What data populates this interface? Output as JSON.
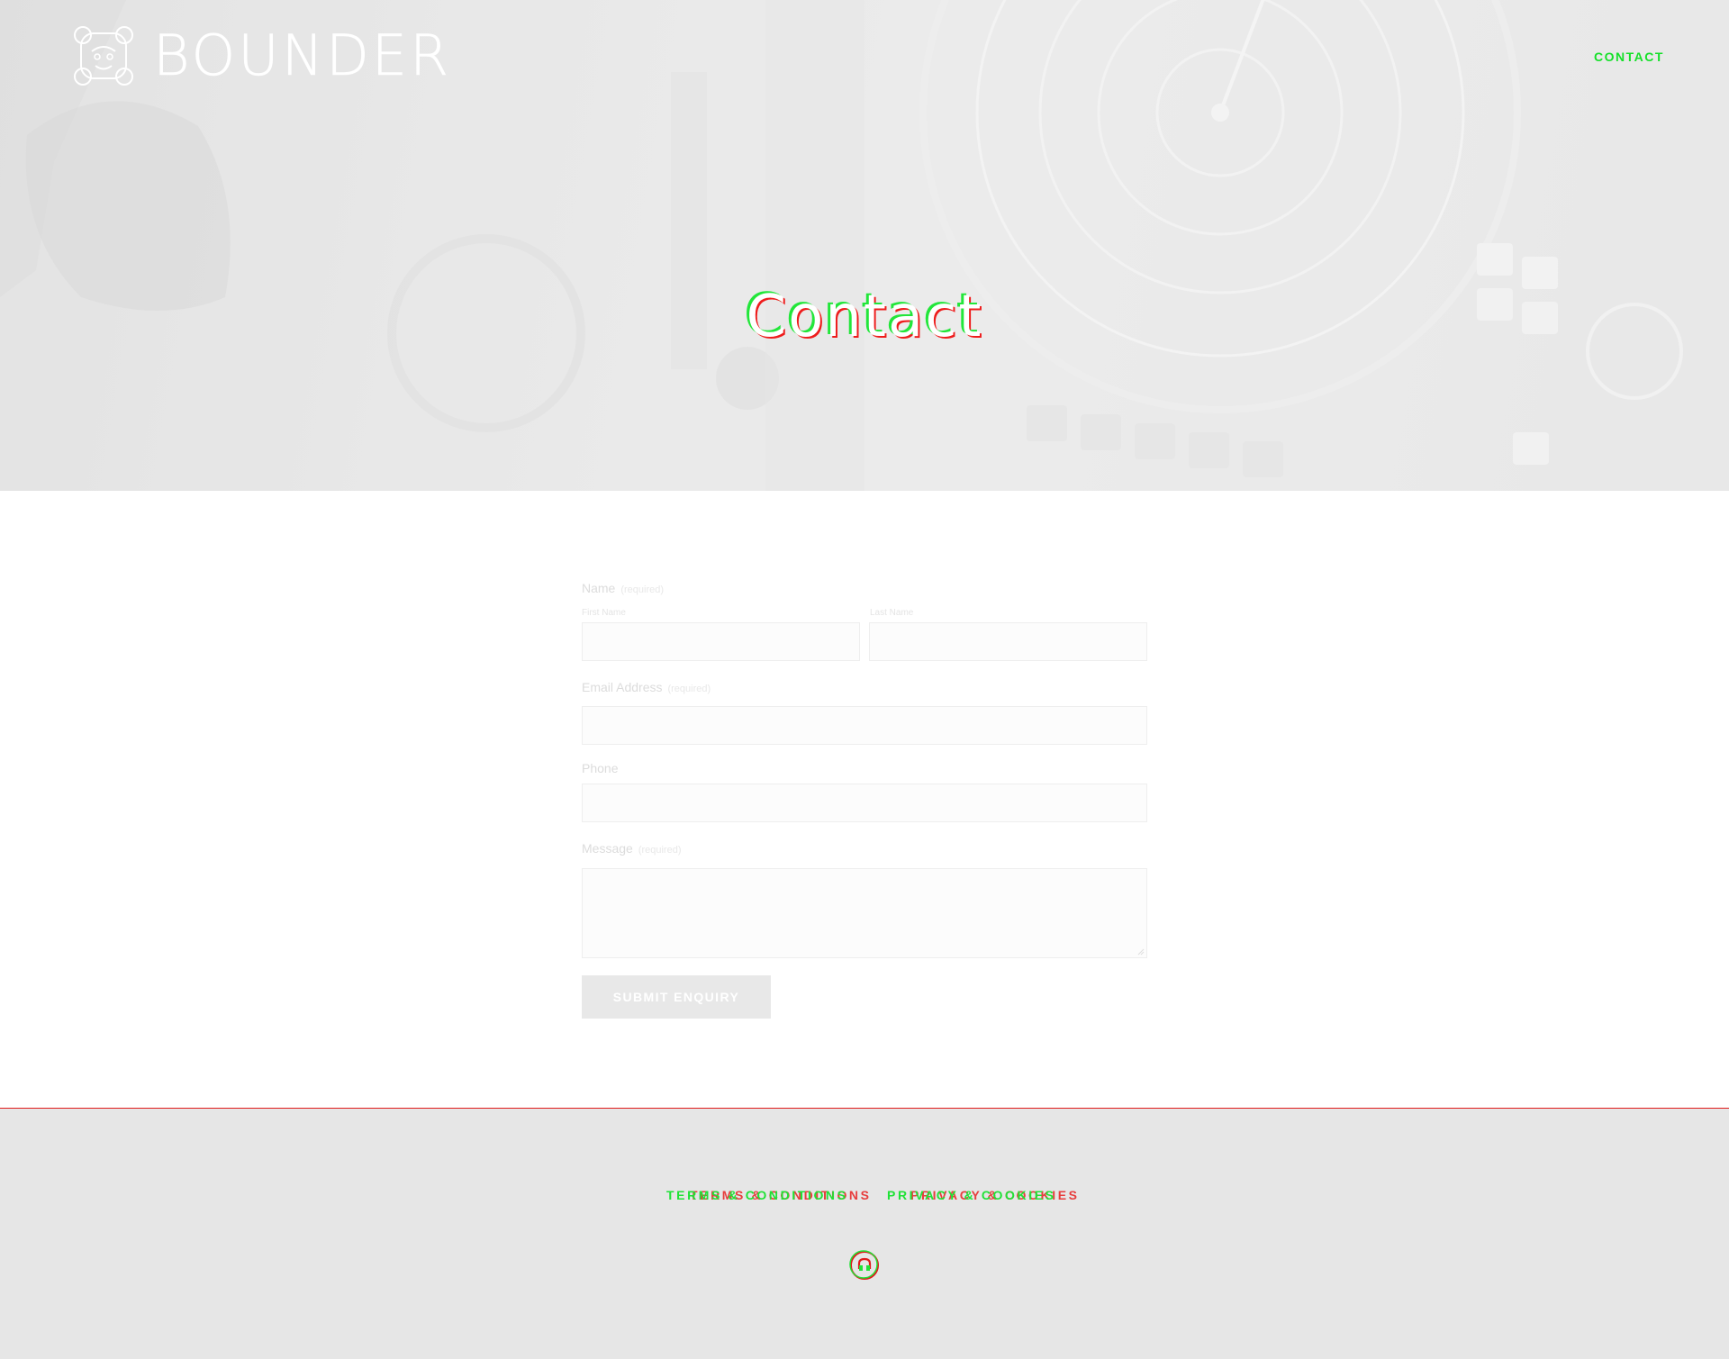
{
  "header": {
    "brand": "BOUNDER",
    "nav": {
      "contact": "CONTACT"
    }
  },
  "hero": {
    "title": "Contact"
  },
  "form": {
    "name": {
      "label": "Name",
      "required": "(required)",
      "first": "First Name",
      "last": "Last Name"
    },
    "email": {
      "label": "Email Address",
      "required": "(required)"
    },
    "phone": {
      "label": "Phone"
    },
    "message": {
      "label": "Message",
      "required": "(required)"
    },
    "submit": "SUBMIT ENQUIRY"
  },
  "footer": {
    "links": [
      "TERMS & CONDITIONS",
      "PRIVACY & COOKIES"
    ],
    "social_icon": "social-circle-icon"
  },
  "colors": {
    "nav_link": "#16e02a",
    "footer_bg": "#e6e6e6",
    "footer_border": "#e01a1a",
    "submit_bg": "#e8e8e8"
  }
}
